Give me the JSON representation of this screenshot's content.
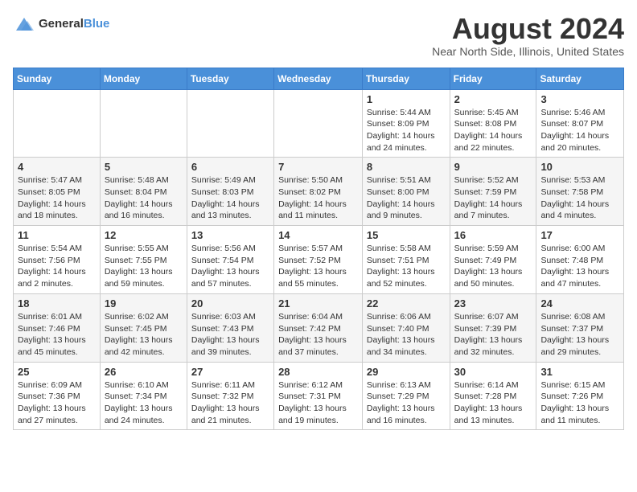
{
  "header": {
    "logo": {
      "line1": "General",
      "line2": "Blue"
    },
    "title": "August 2024",
    "subtitle": "Near North Side, Illinois, United States"
  },
  "days_of_week": [
    "Sunday",
    "Monday",
    "Tuesday",
    "Wednesday",
    "Thursday",
    "Friday",
    "Saturday"
  ],
  "weeks": [
    [
      {
        "day": "",
        "info": ""
      },
      {
        "day": "",
        "info": ""
      },
      {
        "day": "",
        "info": ""
      },
      {
        "day": "",
        "info": ""
      },
      {
        "day": "1",
        "info": "Sunrise: 5:44 AM\nSunset: 8:09 PM\nDaylight: 14 hours and 24 minutes."
      },
      {
        "day": "2",
        "info": "Sunrise: 5:45 AM\nSunset: 8:08 PM\nDaylight: 14 hours and 22 minutes."
      },
      {
        "day": "3",
        "info": "Sunrise: 5:46 AM\nSunset: 8:07 PM\nDaylight: 14 hours and 20 minutes."
      }
    ],
    [
      {
        "day": "4",
        "info": "Sunrise: 5:47 AM\nSunset: 8:05 PM\nDaylight: 14 hours and 18 minutes."
      },
      {
        "day": "5",
        "info": "Sunrise: 5:48 AM\nSunset: 8:04 PM\nDaylight: 14 hours and 16 minutes."
      },
      {
        "day": "6",
        "info": "Sunrise: 5:49 AM\nSunset: 8:03 PM\nDaylight: 14 hours and 13 minutes."
      },
      {
        "day": "7",
        "info": "Sunrise: 5:50 AM\nSunset: 8:02 PM\nDaylight: 14 hours and 11 minutes."
      },
      {
        "day": "8",
        "info": "Sunrise: 5:51 AM\nSunset: 8:00 PM\nDaylight: 14 hours and 9 minutes."
      },
      {
        "day": "9",
        "info": "Sunrise: 5:52 AM\nSunset: 7:59 PM\nDaylight: 14 hours and 7 minutes."
      },
      {
        "day": "10",
        "info": "Sunrise: 5:53 AM\nSunset: 7:58 PM\nDaylight: 14 hours and 4 minutes."
      }
    ],
    [
      {
        "day": "11",
        "info": "Sunrise: 5:54 AM\nSunset: 7:56 PM\nDaylight: 14 hours and 2 minutes."
      },
      {
        "day": "12",
        "info": "Sunrise: 5:55 AM\nSunset: 7:55 PM\nDaylight: 13 hours and 59 minutes."
      },
      {
        "day": "13",
        "info": "Sunrise: 5:56 AM\nSunset: 7:54 PM\nDaylight: 13 hours and 57 minutes."
      },
      {
        "day": "14",
        "info": "Sunrise: 5:57 AM\nSunset: 7:52 PM\nDaylight: 13 hours and 55 minutes."
      },
      {
        "day": "15",
        "info": "Sunrise: 5:58 AM\nSunset: 7:51 PM\nDaylight: 13 hours and 52 minutes."
      },
      {
        "day": "16",
        "info": "Sunrise: 5:59 AM\nSunset: 7:49 PM\nDaylight: 13 hours and 50 minutes."
      },
      {
        "day": "17",
        "info": "Sunrise: 6:00 AM\nSunset: 7:48 PM\nDaylight: 13 hours and 47 minutes."
      }
    ],
    [
      {
        "day": "18",
        "info": "Sunrise: 6:01 AM\nSunset: 7:46 PM\nDaylight: 13 hours and 45 minutes."
      },
      {
        "day": "19",
        "info": "Sunrise: 6:02 AM\nSunset: 7:45 PM\nDaylight: 13 hours and 42 minutes."
      },
      {
        "day": "20",
        "info": "Sunrise: 6:03 AM\nSunset: 7:43 PM\nDaylight: 13 hours and 39 minutes."
      },
      {
        "day": "21",
        "info": "Sunrise: 6:04 AM\nSunset: 7:42 PM\nDaylight: 13 hours and 37 minutes."
      },
      {
        "day": "22",
        "info": "Sunrise: 6:06 AM\nSunset: 7:40 PM\nDaylight: 13 hours and 34 minutes."
      },
      {
        "day": "23",
        "info": "Sunrise: 6:07 AM\nSunset: 7:39 PM\nDaylight: 13 hours and 32 minutes."
      },
      {
        "day": "24",
        "info": "Sunrise: 6:08 AM\nSunset: 7:37 PM\nDaylight: 13 hours and 29 minutes."
      }
    ],
    [
      {
        "day": "25",
        "info": "Sunrise: 6:09 AM\nSunset: 7:36 PM\nDaylight: 13 hours and 27 minutes."
      },
      {
        "day": "26",
        "info": "Sunrise: 6:10 AM\nSunset: 7:34 PM\nDaylight: 13 hours and 24 minutes."
      },
      {
        "day": "27",
        "info": "Sunrise: 6:11 AM\nSunset: 7:32 PM\nDaylight: 13 hours and 21 minutes."
      },
      {
        "day": "28",
        "info": "Sunrise: 6:12 AM\nSunset: 7:31 PM\nDaylight: 13 hours and 19 minutes."
      },
      {
        "day": "29",
        "info": "Sunrise: 6:13 AM\nSunset: 7:29 PM\nDaylight: 13 hours and 16 minutes."
      },
      {
        "day": "30",
        "info": "Sunrise: 6:14 AM\nSunset: 7:28 PM\nDaylight: 13 hours and 13 minutes."
      },
      {
        "day": "31",
        "info": "Sunrise: 6:15 AM\nSunset: 7:26 PM\nDaylight: 13 hours and 11 minutes."
      }
    ]
  ]
}
